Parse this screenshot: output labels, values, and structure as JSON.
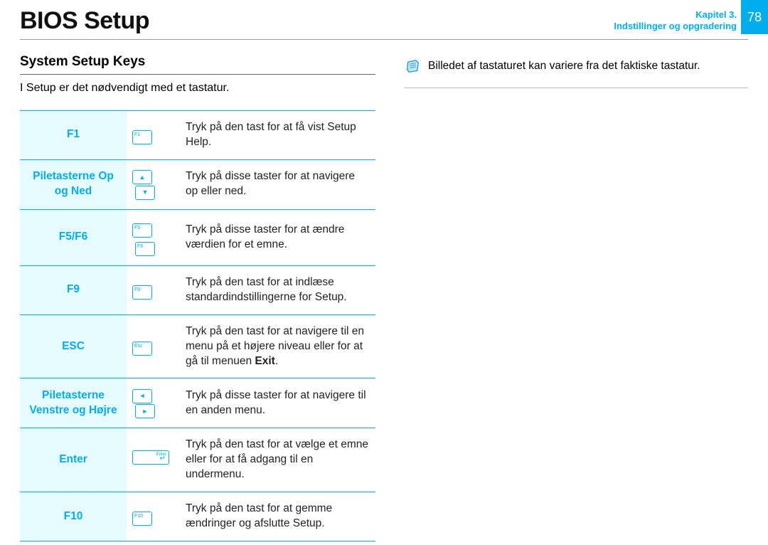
{
  "header": {
    "title": "BIOS Setup",
    "chapter_line1": "Kapitel 3.",
    "chapter_line2": "Indstillinger og opgradering",
    "page_number": "78"
  },
  "section": {
    "title": "System Setup Keys",
    "intro": "I Setup er det nødvendigt med et tastatur."
  },
  "keys": [
    {
      "name": "F1",
      "caps": [
        "F1"
      ],
      "desc": "Tryk på den tast for at få vist Setup Help."
    },
    {
      "name": "Piletasterne Op og Ned",
      "caps_arrows": [
        "▲",
        "▼"
      ],
      "desc": "Tryk på disse taster for at navigere op eller ned."
    },
    {
      "name": "F5/F6",
      "caps": [
        "F5",
        "F6"
      ],
      "desc": "Tryk på disse taster for at ændre værdien for et emne."
    },
    {
      "name": "F9",
      "caps": [
        "F9"
      ],
      "desc": "Tryk på den tast for at indlæse standardindstillingerne for Setup."
    },
    {
      "name": "ESC",
      "caps": [
        "Esc"
      ],
      "desc_pre": "Tryk på den tast for at navigere til en menu på et højere niveau eller for at gå til menuen ",
      "desc_bold": "Exit",
      "desc_post": "."
    },
    {
      "name": "Piletasterne Venstre og Højre",
      "caps_arrows": [
        "◄",
        "►"
      ],
      "desc": "Tryk på disse taster for at navigere til en anden menu."
    },
    {
      "name": "Enter",
      "enter": true,
      "enter_label": "Enter",
      "desc": "Tryk på den tast for at vælge et emne eller for at få adgang til en undermenu."
    },
    {
      "name": "F10",
      "caps": [
        "F10"
      ],
      "desc": "Tryk på den tast for at gemme ændringer og afslutte Setup."
    }
  ],
  "note": {
    "text": "Billedet af tastaturet kan variere fra det faktiske tastatur."
  }
}
